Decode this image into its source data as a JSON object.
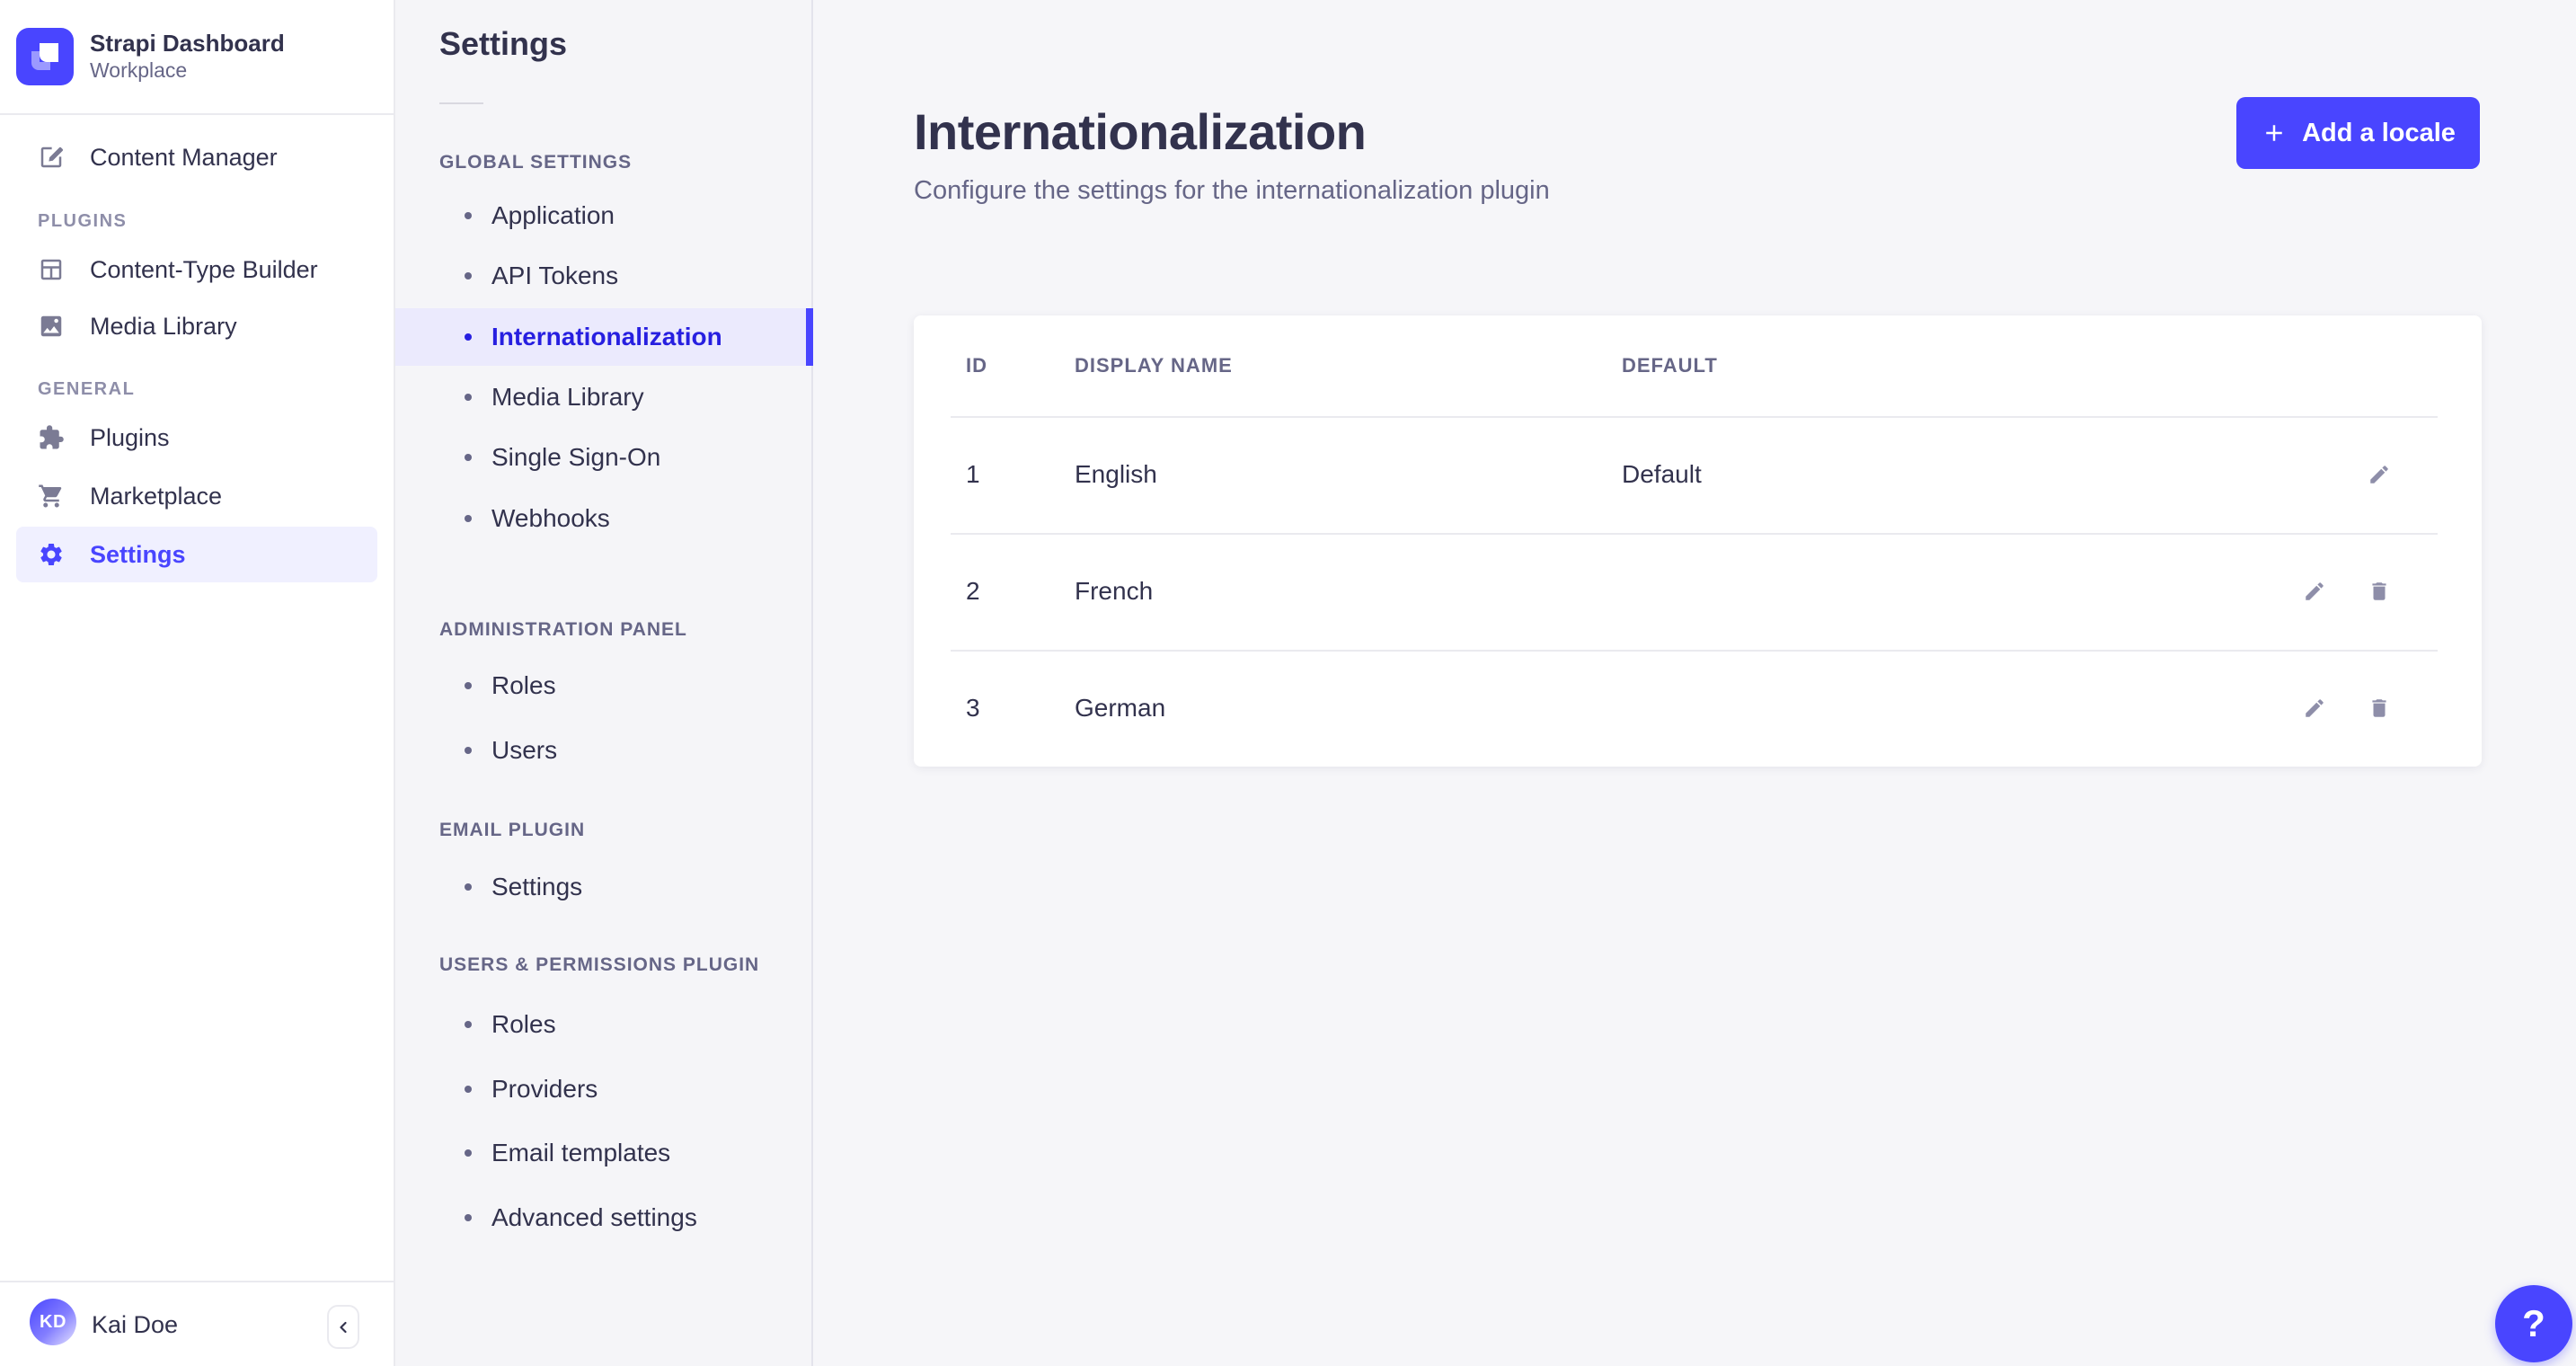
{
  "theme": {
    "primary": "#4945ff",
    "primary_dark_text": "#271fe0",
    "active_item_bg": "#ebeafd",
    "sidebar_active_bg": "#f0f0ff",
    "text": "#32324d",
    "muted_text": "#666687",
    "icon_gray": "#8e8ea9",
    "border": "#eaeaef",
    "background": "#f6f6f9"
  },
  "sidebar": {
    "brand": {
      "title": "Strapi Dashboard",
      "subtitle": "Workplace"
    },
    "sections": [
      {
        "label": "PLUGINS"
      },
      {
        "label": "GENERAL"
      }
    ],
    "items": [
      {
        "label": "Content Manager",
        "icon": "pen-square-icon"
      },
      {
        "label": "Content-Type Builder",
        "icon": "layout-icon"
      },
      {
        "label": "Media Library",
        "icon": "image-icon"
      },
      {
        "label": "Plugins",
        "icon": "puzzle-icon"
      },
      {
        "label": "Marketplace",
        "icon": "cart-icon"
      },
      {
        "label": "Settings",
        "icon": "gear-icon",
        "active": true
      }
    ],
    "user": {
      "name": "Kai Doe",
      "initials": "KD"
    }
  },
  "subnav": {
    "title": "Settings",
    "groups": [
      {
        "label": "GLOBAL SETTINGS",
        "items": [
          {
            "label": "Application"
          },
          {
            "label": "API Tokens"
          },
          {
            "label": "Internationalization",
            "active": true
          },
          {
            "label": "Media Library"
          },
          {
            "label": "Single Sign-On"
          },
          {
            "label": "Webhooks"
          }
        ]
      },
      {
        "label": "ADMINISTRATION PANEL",
        "items": [
          {
            "label": "Roles"
          },
          {
            "label": "Users"
          }
        ]
      },
      {
        "label": "EMAIL PLUGIN",
        "items": [
          {
            "label": "Settings"
          }
        ]
      },
      {
        "label": "USERS & PERMISSIONS PLUGIN",
        "items": [
          {
            "label": "Roles"
          },
          {
            "label": "Providers"
          },
          {
            "label": "Email templates"
          },
          {
            "label": "Advanced settings"
          }
        ]
      }
    ]
  },
  "main": {
    "title": "Internationalization",
    "subtitle": "Configure the settings for the internationalization plugin",
    "add_button_label": "Add a locale",
    "help_label": "?",
    "table": {
      "columns": [
        "ID",
        "DISPLAY NAME",
        "DEFAULT"
      ],
      "rows": [
        {
          "id": "1",
          "display_name": "English",
          "default": "Default",
          "actions": [
            "edit"
          ]
        },
        {
          "id": "2",
          "display_name": "French",
          "default": "",
          "actions": [
            "edit",
            "delete"
          ]
        },
        {
          "id": "3",
          "display_name": "German",
          "default": "",
          "actions": [
            "edit",
            "delete"
          ]
        }
      ]
    }
  }
}
